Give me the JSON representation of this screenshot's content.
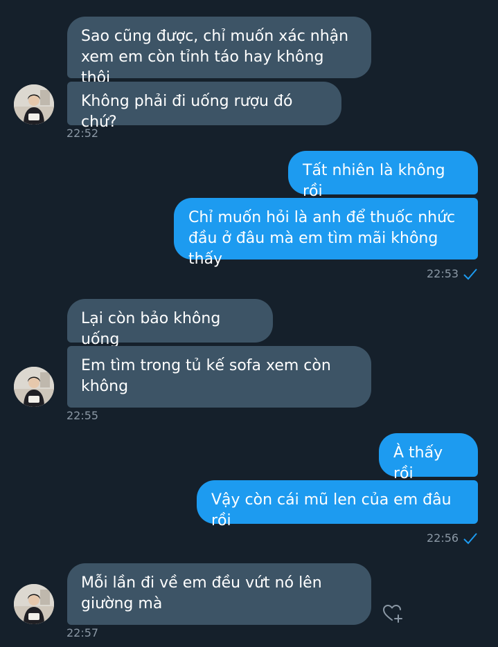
{
  "conversation": {
    "g1": {
      "m1": "Sao cũng được, chỉ muốn xác nhận\nxem em còn tỉnh táo hay không thôi",
      "m2": "Không phải đi uống rượu đó chứ?",
      "time": "22:52"
    },
    "g2": {
      "m1": "Tất nhiên là không rồi",
      "m2": "Chỉ muốn hỏi là anh để thuốc nhức\nđầu ở đâu mà em tìm mãi không thấy",
      "time": "22:53"
    },
    "g3": {
      "m1": "Lại còn bảo không uống",
      "m2": "Em tìm trong tủ kế sofa xem còn\nkhông",
      "time": "22:55"
    },
    "g4": {
      "m1": "À thấy rồi",
      "m2": "Vậy còn cái mũ len của em đâu rồi",
      "time": "22:56"
    },
    "g5": {
      "m1": "Mỗi lần đi về em đều vứt nó lên\ngiường mà",
      "time": "22:57"
    }
  },
  "colors": {
    "background": "#15202b",
    "incoming_bubble": "#3d5466",
    "outgoing_bubble": "#1d9bf0",
    "timestamp": "#8b98a5",
    "read_check": "#1d9bf0"
  },
  "icons": {
    "read_receipt": "check-icon",
    "react": "heart-plus-icon",
    "contact_avatar": "avatar"
  }
}
